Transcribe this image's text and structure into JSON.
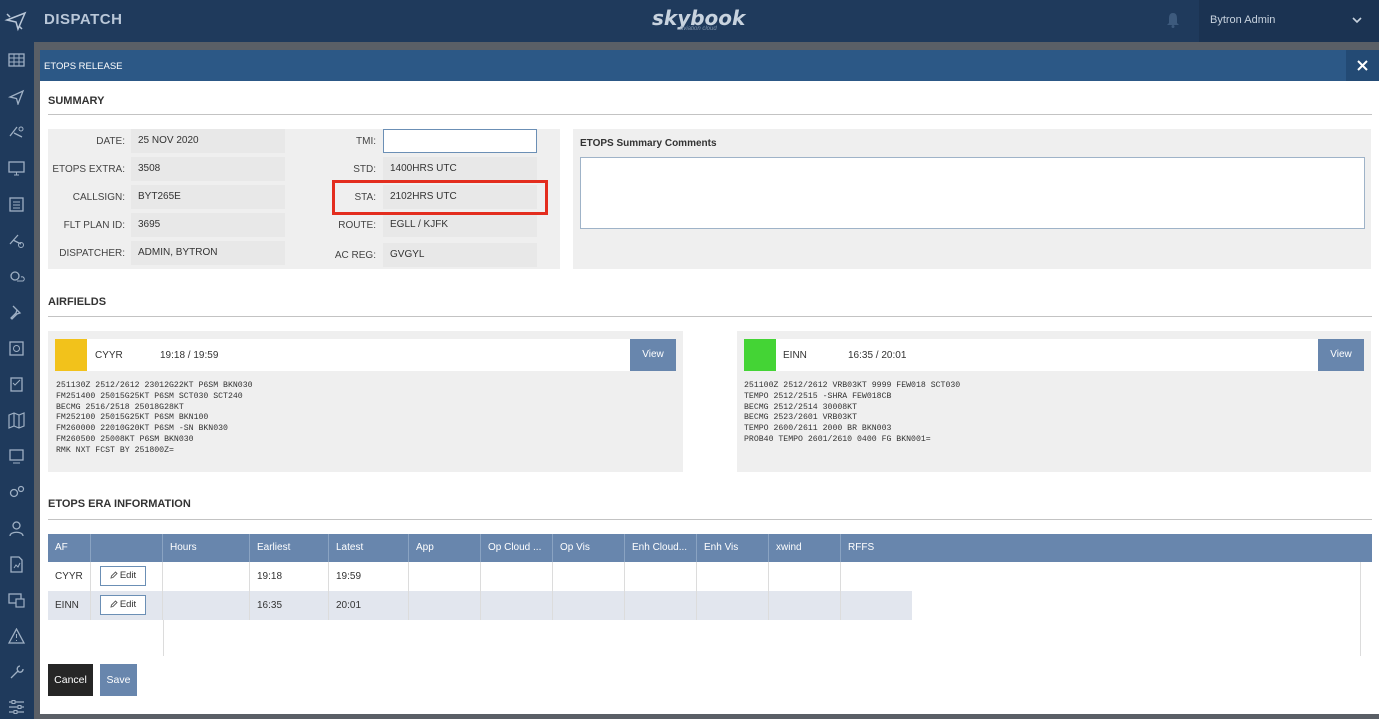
{
  "app": {
    "title": "DISPATCH",
    "brand": "skybook",
    "brand_sub": "aviation cloud",
    "user": "Bytron Admin"
  },
  "sidebar": {
    "icons": [
      "grid-icon",
      "plane-icon",
      "plane-route-icon",
      "monitor-plane-icon",
      "list-icon",
      "plane-settings-icon",
      "weather-icon",
      "pin-icon",
      "document-icon",
      "checklist-icon",
      "map-icon",
      "screen-icon",
      "gears-icon",
      "user-icon",
      "report-icon",
      "display-icon",
      "warning-icon",
      "tools-icon",
      "sliders-icon"
    ]
  },
  "modal": {
    "title": "ETOPS RELEASE",
    "summary": {
      "heading": "SUMMARY",
      "left": [
        {
          "label": "DATE:",
          "value": "25 NOV 2020"
        },
        {
          "label": "ETOPS EXTRA:",
          "value": "3508"
        },
        {
          "label": "CALLSIGN:",
          "value": "BYT265E"
        },
        {
          "label": "FLT PLAN ID:",
          "value": "3695"
        },
        {
          "label": "DISPATCHER:",
          "value": "ADMIN, BYTRON"
        }
      ],
      "right": [
        {
          "label": "TMI:",
          "value": ""
        },
        {
          "label": "STD:",
          "value": "1400HRS UTC"
        },
        {
          "label": "STA:",
          "value": "2102HRS UTC"
        },
        {
          "label": "ROUTE:",
          "value": "EGLL / KJFK"
        },
        {
          "label": "AC REG:",
          "value": "GVGYL"
        }
      ],
      "comments_title": "ETOPS Summary Comments",
      "comments_value": ""
    },
    "airfields": {
      "heading": "AIRFIELDS",
      "items": [
        {
          "code": "CYYR",
          "times": "19:18 / 19:59",
          "status_color": "#f2c21b",
          "view_label": "View",
          "metar": [
            "251130Z 2512/2612 23012G22KT P6SM BKN030",
            "FM251400 25015G25KT P6SM SCT030 SCT240",
            "BECMG 2516/2518 25018G28KT",
            "FM252100 25015G25KT P6SM BKN100",
            "FM260000 22010G20KT P6SM -SN BKN030",
            "FM260500 25008KT P6SM BKN030",
            "RMK NXT FCST BY 251800Z="
          ]
        },
        {
          "code": "EINN",
          "times": "16:35 / 20:01",
          "status_color": "#44d435",
          "view_label": "View",
          "metar": [
            "251100Z 2512/2612 VRB03KT 9999 FEW018 SCT030",
            "TEMPO 2512/2515 -SHRA FEW018CB",
            "BECMG 2512/2514 30008KT",
            "BECMG 2523/2601 VRB03KT",
            "TEMPO 2600/2611 2000 BR BKN003",
            "PROB40 TEMPO 2601/2610 0400 FG BKN001="
          ]
        }
      ]
    },
    "era": {
      "heading": "ETOPS ERA INFORMATION",
      "columns": [
        "AF",
        "",
        "Hours",
        "Earliest",
        "Latest",
        "App",
        "Op Cloud ...",
        "Op Vis",
        "Enh Cloud...",
        "Enh Vis",
        "xwind",
        "RFFS"
      ],
      "rows": [
        {
          "af": "CYYR",
          "edit": "Edit",
          "hours": "",
          "earliest": "19:18",
          "latest": "19:59"
        },
        {
          "af": "EINN",
          "edit": "Edit",
          "hours": "",
          "earliest": "16:35",
          "latest": "20:01"
        }
      ]
    },
    "buttons": {
      "cancel": "Cancel",
      "save": "Save"
    }
  },
  "colors": {
    "header_bg": "#1f3a5c",
    "modal_header": "#2c5886",
    "table_head": "#6886ad",
    "highlight": "#e32d1e"
  }
}
